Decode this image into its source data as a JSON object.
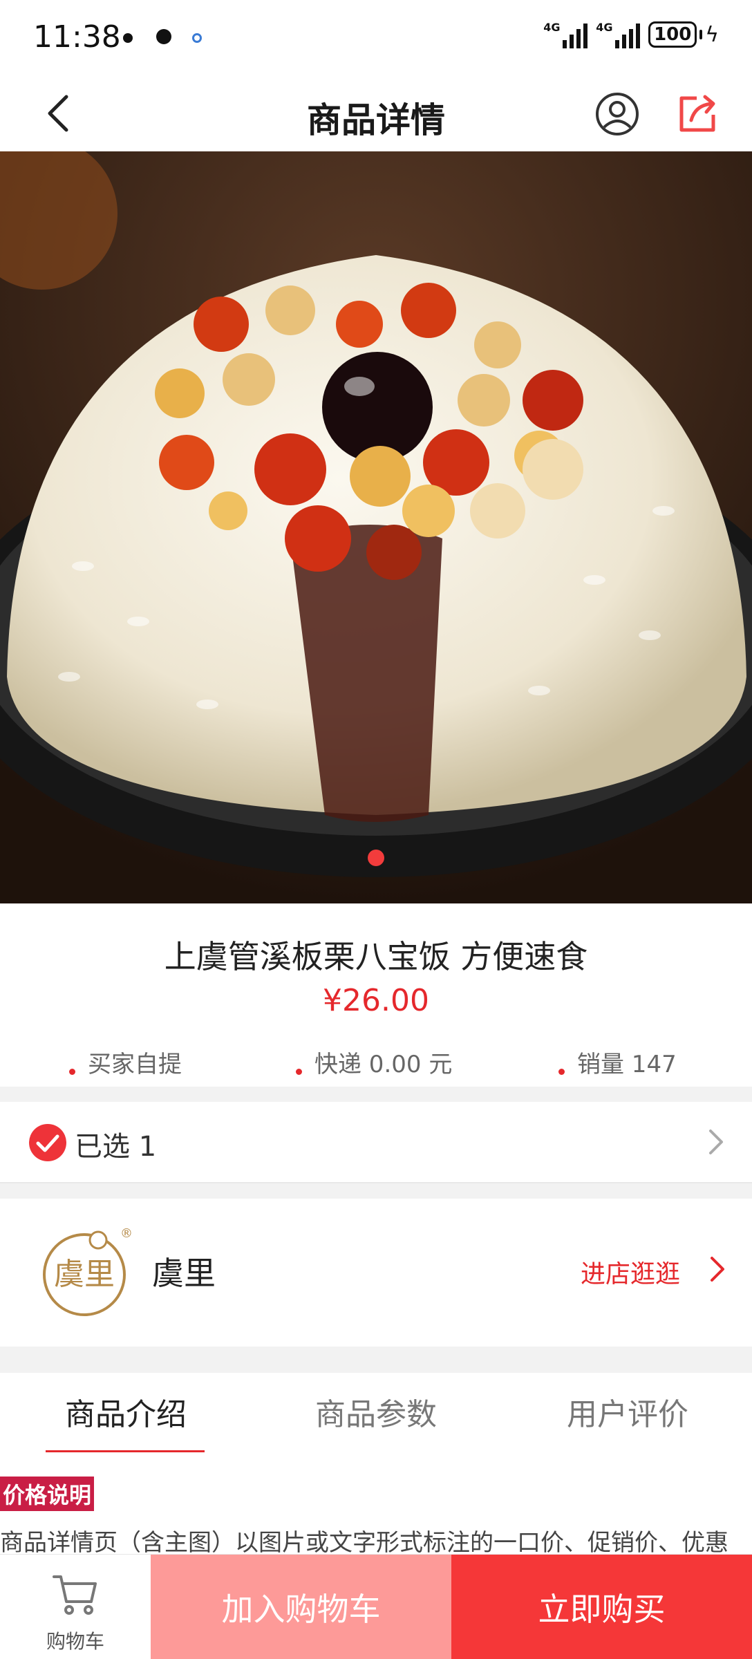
{
  "status": {
    "time": "11:38",
    "net1": "4G",
    "net2": "4G",
    "battery": "100"
  },
  "nav": {
    "title": "商品详情"
  },
  "product": {
    "name": "上虞管溪板栗八宝饭 方便速食",
    "price": "¥26.00",
    "pickup": "买家自提",
    "shipping": "快递  0.00 元",
    "sales": "销量  147"
  },
  "selected": {
    "label": "已选 1"
  },
  "shop": {
    "name": "虞里",
    "logo_text": "虞里",
    "enter": "进店逛逛"
  },
  "tabs": [
    "商品介绍",
    "商品参数",
    "用户评价"
  ],
  "content": {
    "badge": "价格说明",
    "desc": "商品详情页（含主图）以图片或文字形式标注的一口价、促销价、优惠"
  },
  "bottom": {
    "cart": "购物车",
    "add_to_cart": "加入购物车",
    "buy_now": "立即购买"
  },
  "colors": {
    "accent": "#e5282c",
    "add_cart_bg": "#fd9a98",
    "buy_bg": "#f53738",
    "badge_bg": "#c91e45"
  },
  "icons": [
    "back-icon",
    "user-icon",
    "share-icon",
    "check-icon",
    "chevron-right-icon",
    "cart-icon"
  ]
}
